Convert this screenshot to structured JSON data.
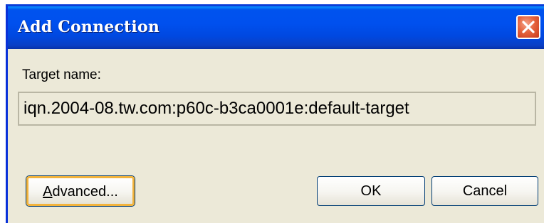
{
  "window": {
    "title": "Add Connection",
    "close_icon": "close-icon",
    "accent_color": "#0050ee",
    "close_color": "#e5633d"
  },
  "form": {
    "target_label": "Target name:",
    "target_value": "iqn.2004-08.tw.com:p60c-b3ca0001e:default-target"
  },
  "buttons": {
    "advanced_mnemonic": "A",
    "advanced_rest": "dvanced...",
    "ok": "OK",
    "cancel": "Cancel"
  }
}
